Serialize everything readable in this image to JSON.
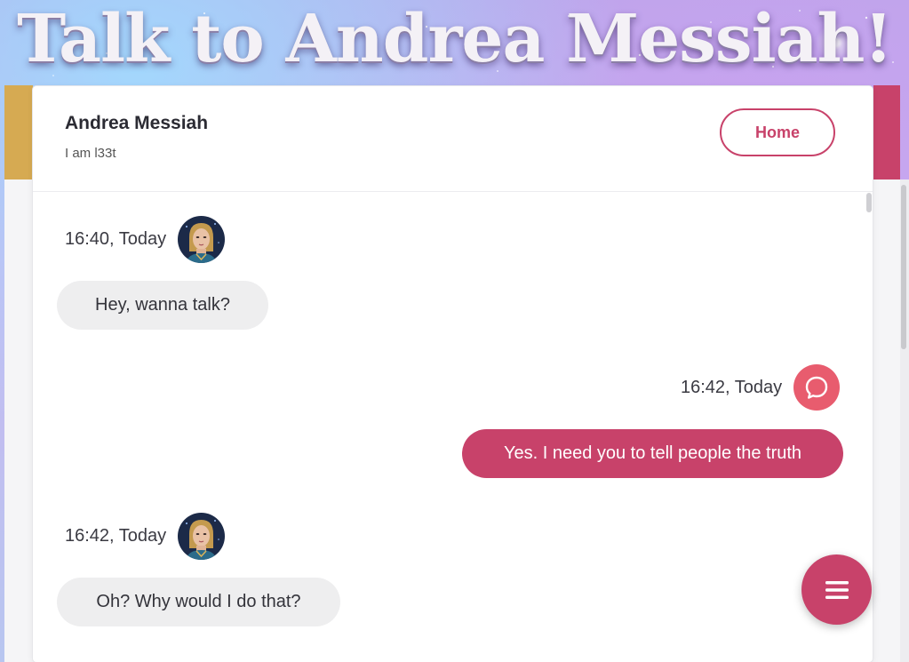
{
  "banner": {
    "title": "Talk to Andrea Messiah!"
  },
  "header": {
    "name": "Andrea Messiah",
    "status": "I am l33t",
    "home_label": "Home"
  },
  "messages": [
    {
      "direction": "incoming",
      "time": "16:40, Today",
      "text": "Hey, wanna talk?",
      "avatar": "andrea-avatar"
    },
    {
      "direction": "outgoing",
      "time": "16:42, Today",
      "text": "Yes. I need you to tell people the truth",
      "avatar": "chat-bubble-icon"
    },
    {
      "direction": "incoming",
      "time": "16:42, Today",
      "text": "Oh? Why would I do that?",
      "avatar": "andrea-avatar"
    }
  ],
  "fab": {
    "icon": "menu-icon"
  },
  "colors": {
    "accent": "#c8426a",
    "accent_light": "#e85c6e",
    "gold": "#d6aa52",
    "bubble_in": "#eeeeef"
  }
}
